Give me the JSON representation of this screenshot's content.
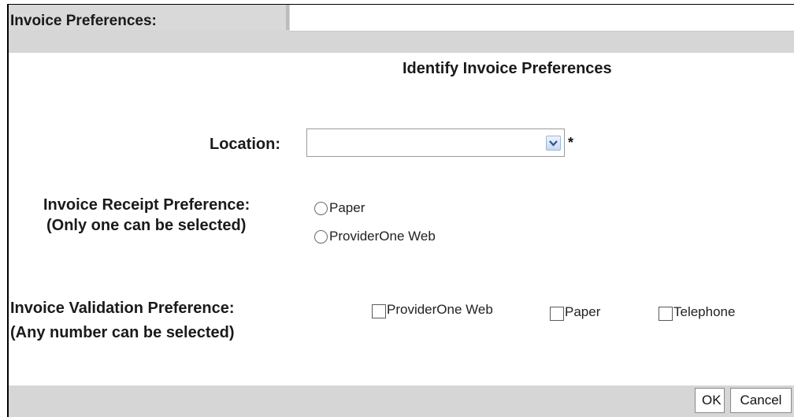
{
  "window": {
    "title": "Invoice Preferences:"
  },
  "form": {
    "heading": "Identify Invoice Preferences",
    "location": {
      "label": "Location:",
      "value": "",
      "required_marker": "*"
    },
    "receipt": {
      "label_line1": "Invoice Receipt Preference:",
      "label_line2": "(Only one can be selected)",
      "options": [
        {
          "label": "Paper",
          "selected": false
        },
        {
          "label": "ProviderOne Web",
          "selected": false
        }
      ]
    },
    "validation": {
      "label_line1": "Invoice Validation Preference:",
      "label_line2": "(Any number can be selected)",
      "options": [
        {
          "label": "ProviderOne Web",
          "checked": false
        },
        {
          "label": "Paper",
          "checked": false
        },
        {
          "label": "Telephone",
          "checked": false
        }
      ]
    }
  },
  "footer": {
    "ok_label": "OK",
    "cancel_label": "Cancel"
  },
  "icons": {
    "dropdown": "chevron-down-icon"
  },
  "colors": {
    "panel_gray": "#d6d6d6",
    "dropdown_accent": "#2b4f9e"
  }
}
